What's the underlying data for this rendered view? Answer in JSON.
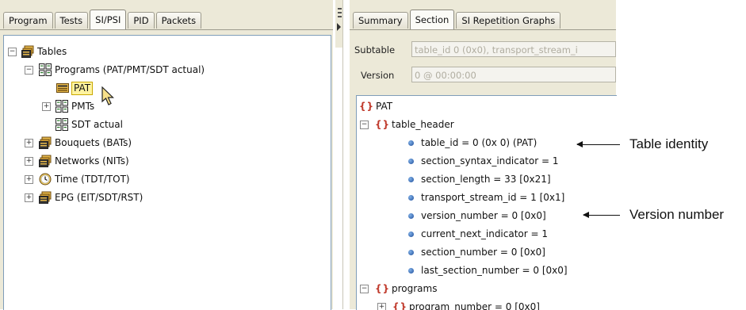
{
  "left_tabs": [
    "Program",
    "Tests",
    "SI/PSI",
    "PID",
    "Packets"
  ],
  "left_tree": {
    "root": "Tables",
    "programs": "Programs (PAT/PMT/SDT actual)",
    "pat": "PAT",
    "pmts": "PMTs",
    "sdt_actual": "SDT actual",
    "bouquets": "Bouquets (BATs)",
    "networks": "Networks (NITs)",
    "time": "Time (TDT/TOT)",
    "epg": "EPG (EIT/SDT/RST)"
  },
  "right_tabs": [
    "Summary",
    "Section",
    "SI Repetition Graphs"
  ],
  "subtable": {
    "label": "Subtable",
    "value": "table_id 0 (0x0), transport_stream_i"
  },
  "version": {
    "label": "Version",
    "value": "0 @ 00:00:00"
  },
  "section_tree": {
    "root": "PAT",
    "braces": "{}",
    "table_header": "table_header",
    "fields": [
      "table_id = 0 (0x 0) (PAT)",
      "section_syntax_indicator = 1",
      "section_length = 33 [0x21]",
      "transport_stream_id = 1 [0x1]",
      "version_number = 0 [0x0]",
      "current_next_indicator = 1",
      "section_number = 0 [0x0]",
      "last_section_number = 0 [0x0]"
    ],
    "programs": "programs",
    "program_number": "program_number = 0 [0x0]"
  },
  "callouts": {
    "table_identity": "Table identity",
    "version_number": "Version number"
  }
}
